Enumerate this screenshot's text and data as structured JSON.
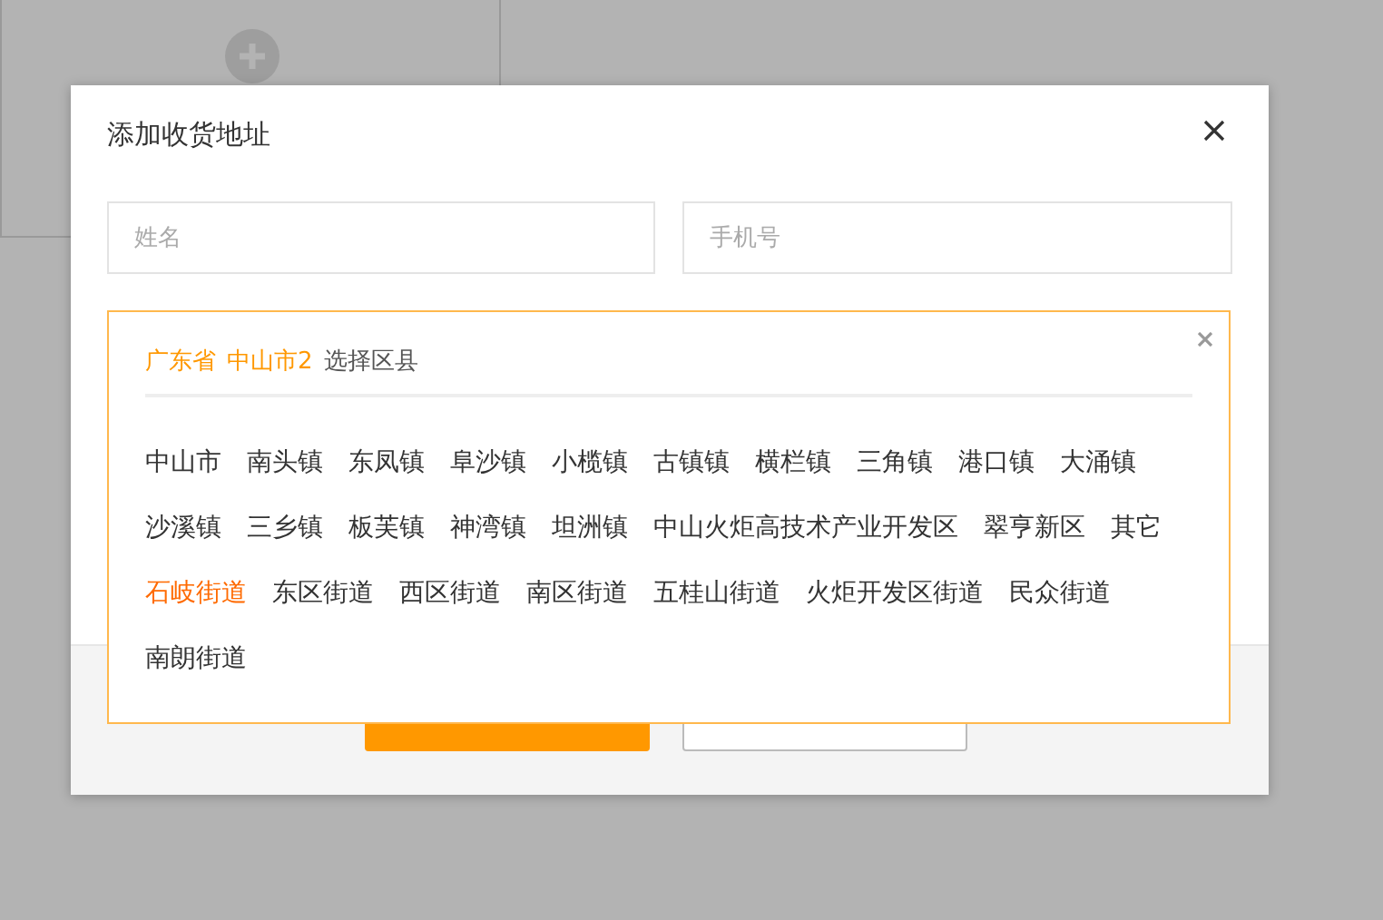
{
  "dialog": {
    "title": "添加收货地址"
  },
  "fields": [
    {
      "placeholder": "姓名"
    },
    {
      "placeholder": "手机号"
    }
  ],
  "region_picker": {
    "path": [
      "广东省",
      "中山市2"
    ],
    "prompt": "选择区县",
    "options": [
      {
        "label": "中山市",
        "selected": false
      },
      {
        "label": "南头镇",
        "selected": false
      },
      {
        "label": "东凤镇",
        "selected": false
      },
      {
        "label": "阜沙镇",
        "selected": false
      },
      {
        "label": "小榄镇",
        "selected": false
      },
      {
        "label": "古镇镇",
        "selected": false
      },
      {
        "label": "横栏镇",
        "selected": false
      },
      {
        "label": "三角镇",
        "selected": false
      },
      {
        "label": "港口镇",
        "selected": false
      },
      {
        "label": "大涌镇",
        "selected": false
      },
      {
        "label": "沙溪镇",
        "selected": false
      },
      {
        "label": "三乡镇",
        "selected": false
      },
      {
        "label": "板芙镇",
        "selected": false
      },
      {
        "label": "神湾镇",
        "selected": false
      },
      {
        "label": "坦洲镇",
        "selected": false
      },
      {
        "label": "中山火炬高技术产业开发区",
        "selected": false
      },
      {
        "label": "翠亨新区",
        "selected": false
      },
      {
        "label": "其它",
        "selected": false
      },
      {
        "label": "石岐街道",
        "selected": true
      },
      {
        "label": "东区街道",
        "selected": false
      },
      {
        "label": "西区街道",
        "selected": false
      },
      {
        "label": "南区街道",
        "selected": false
      },
      {
        "label": "五桂山街道",
        "selected": false
      },
      {
        "label": "火炬开发区街道",
        "selected": false
      },
      {
        "label": "民众街道",
        "selected": false
      },
      {
        "label": "南朗街道",
        "selected": false
      }
    ]
  },
  "buttons": [
    {
      "kind": "primary"
    },
    {
      "kind": "secondary"
    }
  ]
}
